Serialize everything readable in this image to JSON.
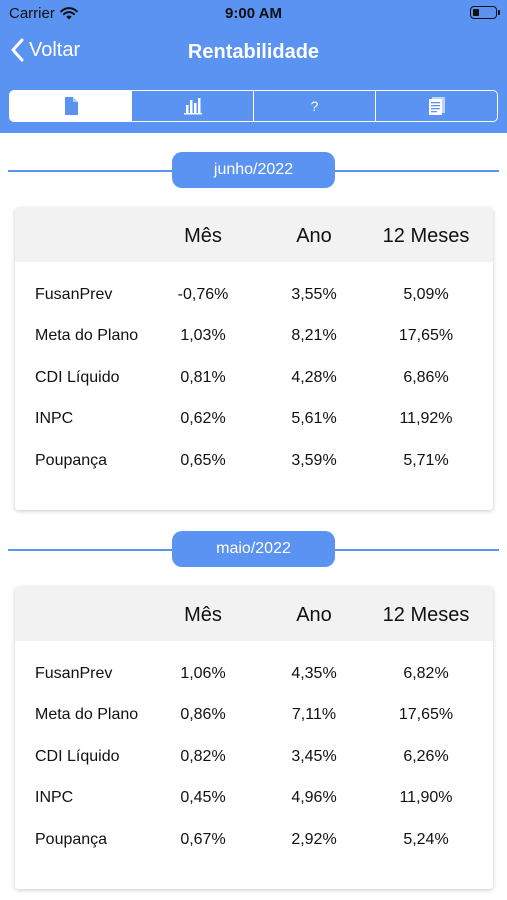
{
  "status": {
    "carrier": "Carrier",
    "time": "9:00 AM",
    "battery_level": 0.3
  },
  "nav": {
    "back_label": "Voltar",
    "title": "Rentabilidade"
  },
  "tabs": [
    {
      "icon": "document-icon",
      "active": true
    },
    {
      "icon": "bar-chart-icon",
      "active": false
    },
    {
      "label": "?",
      "active": false
    },
    {
      "icon": "list-icon",
      "active": false
    }
  ],
  "columns": [
    "Mês",
    "Ano",
    "12 Meses"
  ],
  "months": [
    {
      "label": "junho/2022",
      "rows": [
        {
          "name": "FusanPrev",
          "mes": "-0,76%",
          "ano": "3,55%",
          "doze": "5,09%"
        },
        {
          "name": "Meta do Plano",
          "mes": "1,03%",
          "ano": "8,21%",
          "doze": "17,65%"
        },
        {
          "name": "CDI Líquido",
          "mes": "0,81%",
          "ano": "4,28%",
          "doze": "6,86%"
        },
        {
          "name": "INPC",
          "mes": "0,62%",
          "ano": "5,61%",
          "doze": "11,92%"
        },
        {
          "name": "Poupança",
          "mes": "0,65%",
          "ano": "3,59%",
          "doze": "5,71%"
        }
      ]
    },
    {
      "label": "maio/2022",
      "rows": [
        {
          "name": "FusanPrev",
          "mes": "1,06%",
          "ano": "4,35%",
          "doze": "6,82%"
        },
        {
          "name": "Meta do Plano",
          "mes": "0,86%",
          "ano": "7,11%",
          "doze": "17,65%"
        },
        {
          "name": "CDI Líquido",
          "mes": "0,82%",
          "ano": "3,45%",
          "doze": "6,26%"
        },
        {
          "name": "INPC",
          "mes": "0,45%",
          "ano": "4,96%",
          "doze": "11,90%"
        },
        {
          "name": "Poupança",
          "mes": "0,67%",
          "ano": "2,92%",
          "doze": "5,24%"
        }
      ]
    }
  ],
  "colors": {
    "accent": "#5b93f2",
    "header_bg": "#f2f2f2"
  }
}
